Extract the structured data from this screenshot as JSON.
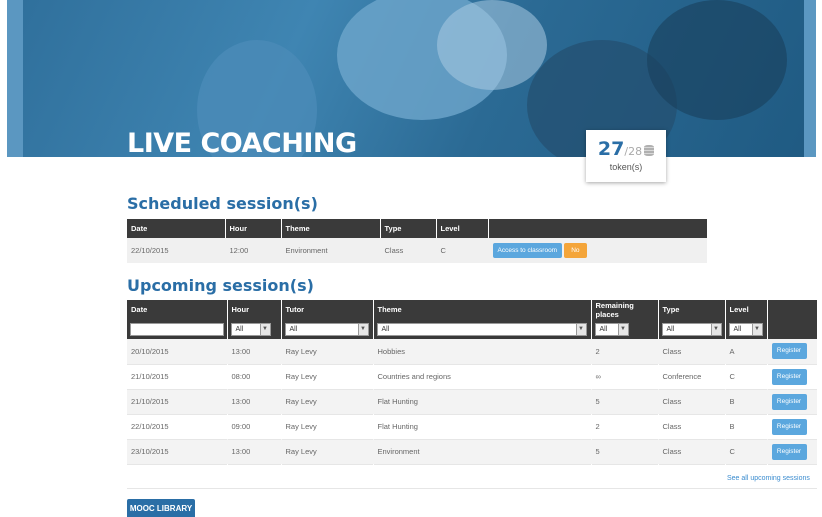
{
  "hero": {
    "title": "LIVE COACHING"
  },
  "tokens": {
    "current": "27",
    "total": "/28",
    "label": "token(s)"
  },
  "scheduled": {
    "title": "Scheduled session(s)",
    "headers": [
      "Date",
      "Hour",
      "Theme",
      "Type",
      "Level",
      ""
    ],
    "rows": [
      {
        "date": "22/10/2015",
        "hour": "12:00",
        "theme": "Environment",
        "type": "Class",
        "level": "C",
        "access_label": "Access to classroom",
        "no_label": "No"
      }
    ]
  },
  "upcoming": {
    "title": "Upcoming session(s)",
    "headers": [
      "Date",
      "Hour",
      "Tutor",
      "Theme",
      "Remaining places",
      "Type",
      "Level",
      ""
    ],
    "filters": {
      "date": "",
      "hour": "All",
      "tutor": "All",
      "theme": "All",
      "places": "All",
      "type": "All",
      "level": "All"
    },
    "rows": [
      {
        "date": "20/10/2015",
        "hour": "13:00",
        "tutor": "Ray Levy",
        "theme": "Hobbies",
        "places": "2",
        "type": "Class",
        "level": "A",
        "action": "Register"
      },
      {
        "date": "21/10/2015",
        "hour": "08:00",
        "tutor": "Ray Levy",
        "theme": "Countries and regions",
        "places": "∞",
        "type": "Conference",
        "level": "C",
        "action": "Register"
      },
      {
        "date": "21/10/2015",
        "hour": "13:00",
        "tutor": "Ray Levy",
        "theme": "Flat Hunting",
        "places": "5",
        "type": "Class",
        "level": "B",
        "action": "Register"
      },
      {
        "date": "22/10/2015",
        "hour": "09:00",
        "tutor": "Ray Levy",
        "theme": "Flat Hunting",
        "places": "2",
        "type": "Class",
        "level": "B",
        "action": "Register"
      },
      {
        "date": "23/10/2015",
        "hour": "13:00",
        "tutor": "Ray Levy",
        "theme": "Environment",
        "places": "5",
        "type": "Class",
        "level": "C",
        "action": "Register"
      }
    ],
    "see_all": "See all upcoming sessions"
  },
  "mooc_button": "MOOC LIBRARY",
  "colors": {
    "accent": "#2a6ea6",
    "register": "#5ba7de",
    "no_button": "#f4a53a",
    "table_header": "#3a3a3a"
  }
}
